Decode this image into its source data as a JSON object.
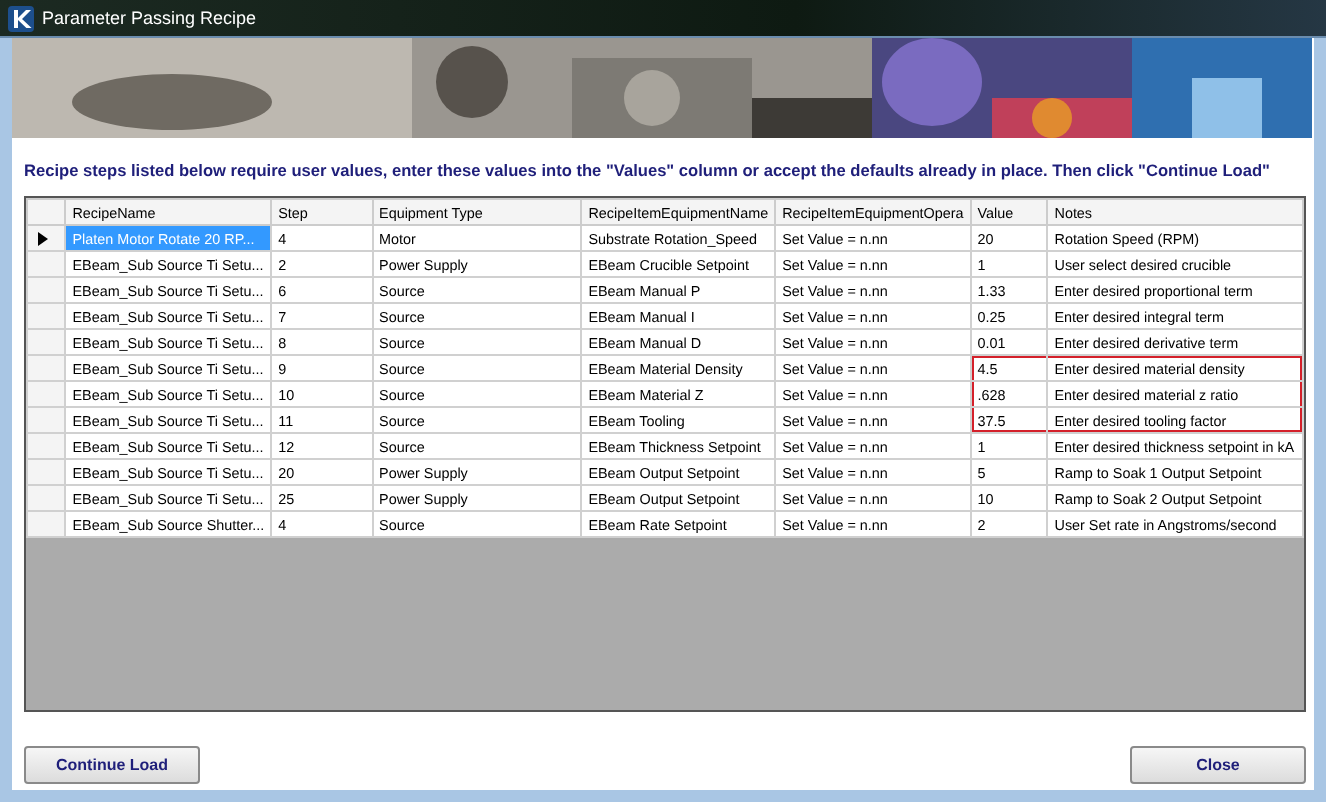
{
  "window": {
    "title": "Parameter Passing Recipe"
  },
  "instruction": "Recipe steps listed below require user values, enter these values into the \"Values\" column or accept the defaults already in place. Then click \"Continue Load\"",
  "table": {
    "columns": [
      "RecipeName",
      "Step",
      "Equipment Type",
      "RecipeItemEquipmentName",
      "RecipeItemEquipmentOpera",
      "Value",
      "Notes"
    ],
    "rows": [
      {
        "selected": true,
        "highlighted": false,
        "cells": [
          "Platen Motor Rotate 20 RP...",
          "4",
          "Motor",
          "Substrate Rotation_Speed",
          "Set Value = n.nn",
          "20",
          "Rotation Speed (RPM)"
        ]
      },
      {
        "selected": false,
        "highlighted": false,
        "cells": [
          "EBeam_Sub Source Ti Setu...",
          "2",
          "Power Supply",
          "EBeam Crucible Setpoint",
          "Set Value = n.nn",
          "1",
          "User select desired crucible"
        ]
      },
      {
        "selected": false,
        "highlighted": false,
        "cells": [
          "EBeam_Sub Source Ti Setu...",
          "6",
          "Source",
          "EBeam Manual P",
          "Set Value = n.nn",
          "1.33",
          "Enter desired proportional term"
        ]
      },
      {
        "selected": false,
        "highlighted": false,
        "cells": [
          "EBeam_Sub Source Ti Setu...",
          "7",
          "Source",
          "EBeam Manual I",
          "Set Value = n.nn",
          "0.25",
          "Enter desired integral term"
        ]
      },
      {
        "selected": false,
        "highlighted": false,
        "cells": [
          "EBeam_Sub Source Ti Setu...",
          "8",
          "Source",
          "EBeam Manual D",
          "Set Value = n.nn",
          "0.01",
          "Enter desired derivative term"
        ]
      },
      {
        "selected": false,
        "highlighted": true,
        "cells": [
          "EBeam_Sub Source Ti Setu...",
          "9",
          "Source",
          "EBeam Material Density",
          "Set Value = n.nn",
          "4.5",
          "Enter desired material density"
        ]
      },
      {
        "selected": false,
        "highlighted": true,
        "cells": [
          "EBeam_Sub Source Ti Setu...",
          "10",
          "Source",
          "EBeam Material Z",
          "Set Value = n.nn",
          ".628",
          "Enter desired material z ratio"
        ]
      },
      {
        "selected": false,
        "highlighted": true,
        "cells": [
          "EBeam_Sub Source Ti Setu...",
          "11",
          "Source",
          "EBeam Tooling",
          "Set Value = n.nn",
          "37.5",
          "Enter desired tooling factor"
        ]
      },
      {
        "selected": false,
        "highlighted": false,
        "cells": [
          "EBeam_Sub Source Ti Setu...",
          "12",
          "Source",
          "EBeam Thickness Setpoint",
          "Set Value = n.nn",
          "1",
          "Enter desired thickness setpoint in kA"
        ]
      },
      {
        "selected": false,
        "highlighted": false,
        "cells": [
          "EBeam_Sub Source Ti Setu...",
          "20",
          "Power Supply",
          "EBeam Output Setpoint",
          "Set Value = n.nn",
          "5",
          "Ramp to Soak 1 Output Setpoint"
        ]
      },
      {
        "selected": false,
        "highlighted": false,
        "cells": [
          "EBeam_Sub Source Ti Setu...",
          "25",
          "Power Supply",
          "EBeam Output Setpoint",
          "Set Value = n.nn",
          "10",
          "Ramp to Soak 2 Output Setpoint"
        ]
      },
      {
        "selected": false,
        "highlighted": false,
        "cells": [
          "EBeam_Sub Source Shutter...",
          "4",
          "Source",
          "EBeam Rate Setpoint",
          "Set Value = n.nn",
          "2",
          "User Set  rate in Angstroms/second"
        ]
      }
    ]
  },
  "buttons": [
    "Continue Load",
    "Close"
  ]
}
